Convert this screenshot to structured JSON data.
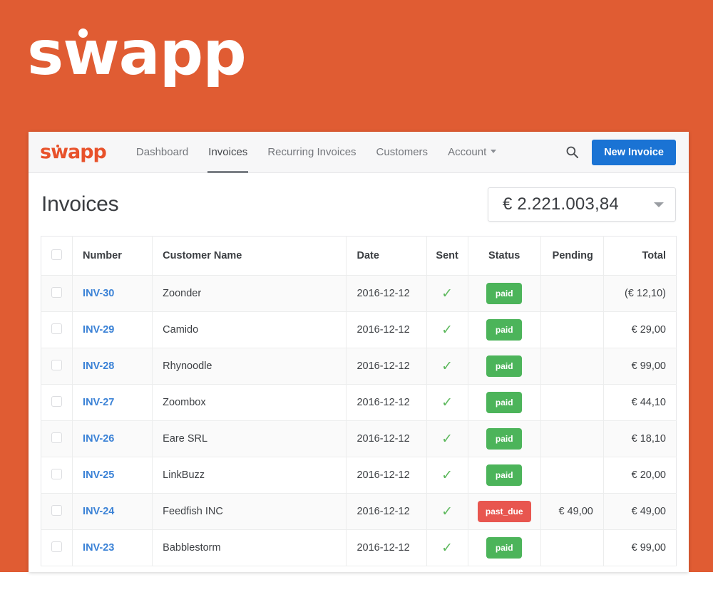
{
  "brand": {
    "hero_wordmark": "swapp",
    "nav_wordmark": "swapp",
    "orange": "#e05c33",
    "logo_orange": "#e8522b"
  },
  "nav": {
    "links": [
      {
        "label": "Dashboard",
        "active": false
      },
      {
        "label": "Invoices",
        "active": true
      },
      {
        "label": "Recurring Invoices",
        "active": false
      },
      {
        "label": "Customers",
        "active": false
      },
      {
        "label": "Account",
        "active": false,
        "caret": true
      }
    ],
    "search_icon": "search-icon",
    "new_invoice_label": "New Invoice",
    "new_invoice_color": "#1a73d4"
  },
  "page": {
    "title": "Invoices",
    "total_select_value": "€ 2.221.003,84"
  },
  "table": {
    "columns": [
      "Number",
      "Customer Name",
      "Date",
      "Sent",
      "Status",
      "Pending",
      "Total"
    ],
    "rows": [
      {
        "number": "INV-30",
        "customer": "Zoonder",
        "date": "2016-12-12",
        "sent": "✓",
        "status": "paid",
        "status_kind": "paid",
        "pending": "",
        "total": "(€ 12,10)"
      },
      {
        "number": "INV-29",
        "customer": "Camido",
        "date": "2016-12-12",
        "sent": "✓",
        "status": "paid",
        "status_kind": "paid",
        "pending": "",
        "total": "€ 29,00"
      },
      {
        "number": "INV-28",
        "customer": "Rhynoodle",
        "date": "2016-12-12",
        "sent": "✓",
        "status": "paid",
        "status_kind": "paid",
        "pending": "",
        "total": "€ 99,00"
      },
      {
        "number": "INV-27",
        "customer": "Zoombox",
        "date": "2016-12-12",
        "sent": "✓",
        "status": "paid",
        "status_kind": "paid",
        "pending": "",
        "total": "€ 44,10"
      },
      {
        "number": "INV-26",
        "customer": "Eare SRL",
        "date": "2016-12-12",
        "sent": "✓",
        "status": "paid",
        "status_kind": "paid",
        "pending": "",
        "total": "€ 18,10"
      },
      {
        "number": "INV-25",
        "customer": "LinkBuzz",
        "date": "2016-12-12",
        "sent": "✓",
        "status": "paid",
        "status_kind": "paid",
        "pending": "",
        "total": "€ 20,00"
      },
      {
        "number": "INV-24",
        "customer": "Feedfish INC",
        "date": "2016-12-12",
        "sent": "✓",
        "status": "past_due",
        "status_kind": "past_due",
        "pending": "€ 49,00",
        "total": "€ 49,00"
      },
      {
        "number": "INV-23",
        "customer": "Babblestorm",
        "date": "2016-12-12",
        "sent": "✓",
        "status": "paid",
        "status_kind": "paid",
        "pending": "",
        "total": "€ 99,00"
      }
    ],
    "status_colors": {
      "paid": "#4cb45a",
      "past_due": "#e8564f"
    },
    "link_color": "#3b82d6"
  }
}
